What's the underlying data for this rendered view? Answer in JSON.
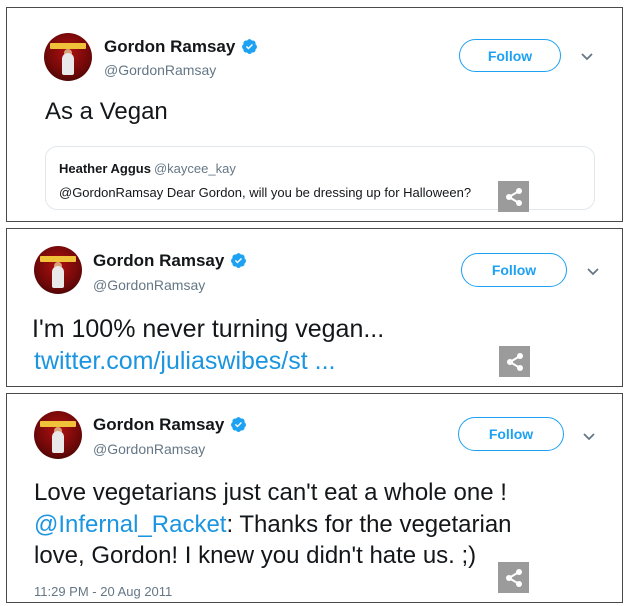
{
  "tweets": [
    {
      "author_name": "Gordon Ramsay",
      "handle": "@GordonRamsay",
      "follow_label": "Follow",
      "text": "As a Vegan",
      "quote": {
        "name": "Heather Aggus",
        "handle": "@kaycee_kay",
        "text": "@GordonRamsay Dear Gordon, will you be dressing up for Halloween?"
      }
    },
    {
      "author_name": "Gordon Ramsay",
      "handle": "@GordonRamsay",
      "follow_label": "Follow",
      "text": "I'm 100% never turning vegan...",
      "link": "twitter.com/juliaswibes/st ..."
    },
    {
      "author_name": "Gordon Ramsay",
      "handle": "@GordonRamsay",
      "follow_label": "Follow",
      "line1": "Love vegetarians just can't eat a whole one !",
      "mention": "@Infernal_Racket",
      "line2_rest": ":  Thanks for the vegetarian",
      "line3": "love, Gordon! I knew you didn't hate us. ;)",
      "timestamp": "11:29 PM - 20 Aug 2011"
    }
  ],
  "icons": {
    "verified": "verified-badge-icon",
    "chevron": "chevron-down-icon",
    "share": "share-icon"
  },
  "colors": {
    "twitter_blue": "#1da1f2",
    "link_blue": "#1b95e0",
    "secondary_text": "#657786",
    "share_bg": "#9b9b9b"
  }
}
